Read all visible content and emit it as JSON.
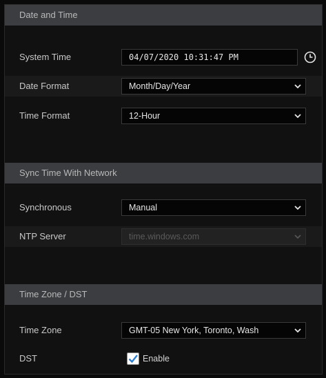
{
  "sections": {
    "date_time": {
      "title": "Date and Time"
    },
    "sync": {
      "title": "Sync Time With Network"
    },
    "timezone": {
      "title": "Time Zone / DST"
    }
  },
  "fields": {
    "system_time": {
      "label": "System Time",
      "value": "04/07/2020 10:31:47 PM"
    },
    "date_format": {
      "label": "Date Format",
      "value": "Month/Day/Year"
    },
    "time_format": {
      "label": "Time Format",
      "value": "12-Hour"
    },
    "synchronous": {
      "label": "Synchronous",
      "value": "Manual"
    },
    "ntp_server": {
      "label": "NTP Server",
      "value": "time.windows.com"
    },
    "time_zone": {
      "label": "Time Zone",
      "value": "GMT-05 New York, Toronto, Wash"
    },
    "dst": {
      "label": "DST",
      "checkbox_label": "Enable",
      "checked": true
    }
  },
  "icons": {
    "clock": "clock-icon",
    "dropdown": "chevron-down-icon",
    "check": "check-icon"
  },
  "colors": {
    "header_bg": "#3b3d40",
    "panel_bg": "#111111",
    "checkbox_check": "#2f7fd1"
  }
}
